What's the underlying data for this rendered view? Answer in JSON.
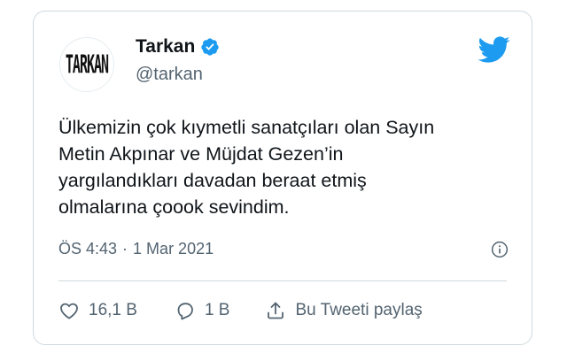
{
  "author": {
    "avatar_text": "TARKAN",
    "display_name": "Tarkan",
    "handle": "@tarkan",
    "verified": true
  },
  "tweet": {
    "lines": [
      "Ülkemizin çok kıymetli sanatçıları olan Sayın",
      "Metin Akpınar ve Müjdat Gezen’in",
      "yargılandıkları davadan beraat etmiş",
      "olmalarına çoook sevindim."
    ],
    "time": "ÖS 4:43",
    "separator": "·",
    "date": "1 Mar 2021"
  },
  "actions": {
    "likes_label": "16,1 B",
    "replies_label": "1 B",
    "share_label": "Bu Tweeti paylaş"
  },
  "icons": {
    "brand": "twitter-bird-icon",
    "info": "info-icon",
    "like": "heart-icon",
    "reply": "reply-icon",
    "share": "share-icon",
    "verified": "verified-badge-icon"
  },
  "colors": {
    "brand": "#1d9bf0",
    "text_primary": "#0f1419",
    "text_secondary": "#536471",
    "border": "#cfd9de"
  }
}
